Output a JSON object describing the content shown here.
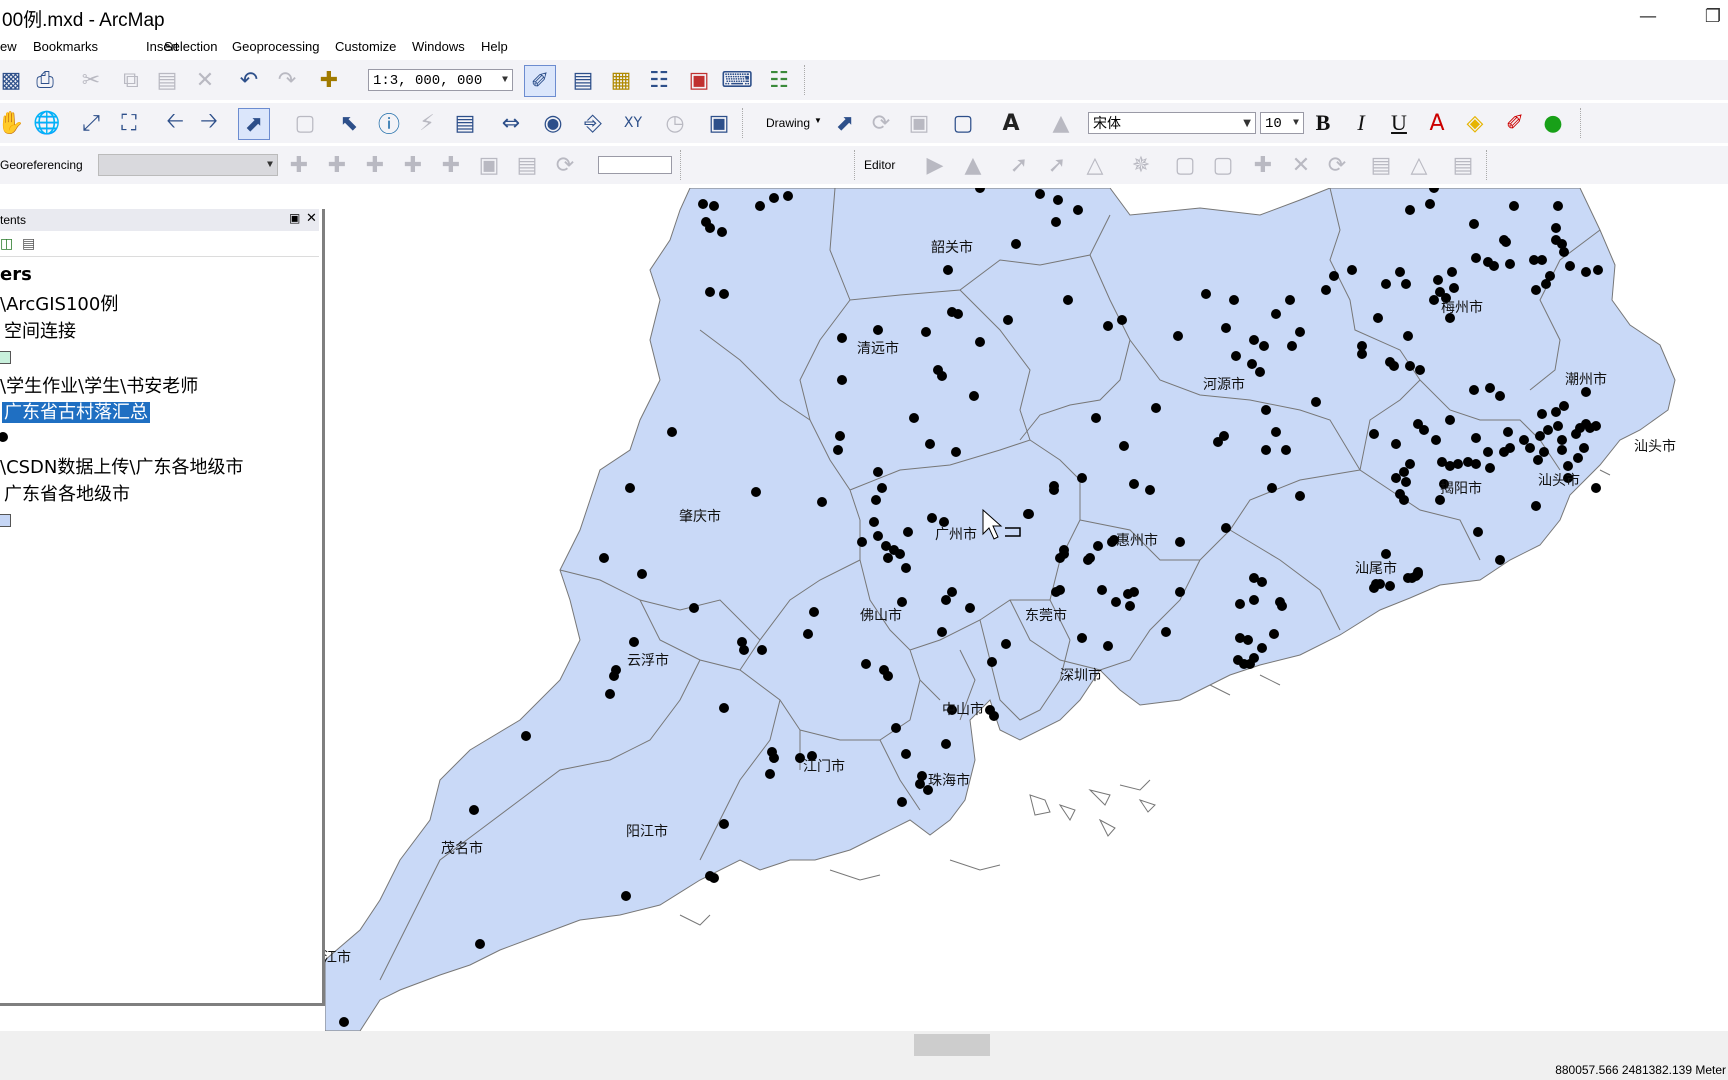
{
  "window": {
    "title": "00例.mxd - ArcMap",
    "minimize_icon": "minimize-icon",
    "restore_icon": "restore-icon"
  },
  "menu": [
    "ew",
    "Bookmarks",
    "Insert",
    "Selection",
    "Geoprocessing",
    "Customize",
    "Windows",
    "Help"
  ],
  "standard_toolbar": {
    "scale": "1:3, 000, 000"
  },
  "draw_toolbar": {
    "drawing_label": "Drawing",
    "font_name": "宋体",
    "font_size": "10",
    "bold": "B",
    "italic": "I",
    "underline": "U"
  },
  "georef_toolbar": {
    "georeferencing_label": "Georeferencing",
    "editor_label": "Editor"
  },
  "toc": {
    "header": "tents",
    "root": "ers",
    "items": [
      {
        "text": "\\ArcGIS100例"
      },
      {
        "text": "空间连接"
      },
      {
        "text": "\\学生作业\\学生\\书安老师"
      },
      {
        "text": "广东省古村落汇总"
      },
      {
        "text": "\\CSDN数据上传\\广东各地级市"
      },
      {
        "text": "广东省各地级市"
      }
    ],
    "symbol_colors": {
      "join_fill": "#c8f0dc",
      "city_fill": "#c6d6f5",
      "point": "#000000"
    }
  },
  "map": {
    "fill_color": "#c9d9f7",
    "stroke_color": "#666666",
    "cities": [
      "韶关市",
      "清远市",
      "河源市",
      "梅州市",
      "潮州市",
      "汕头市",
      "汕头市",
      "揭阳市",
      "肇庆市",
      "广州市",
      "惠州市",
      "汕尾市",
      "佛山市",
      "东莞市",
      "云浮市",
      "深圳市",
      "中山市",
      "江门市",
      "珠海市",
      "阳江市",
      "茂名市",
      "江市"
    ]
  },
  "status": {
    "coords": "880057.566  2481382.139 Meter"
  }
}
